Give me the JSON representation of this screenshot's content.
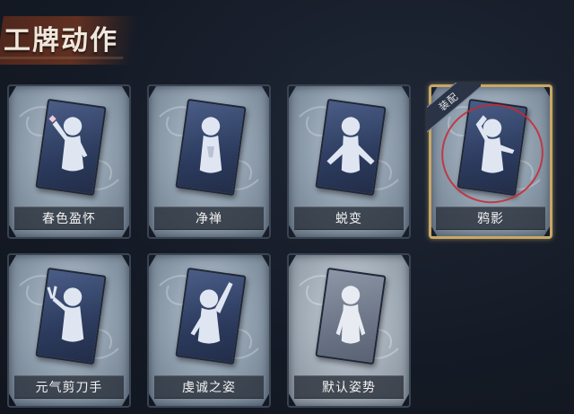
{
  "header": {
    "title": "工牌动作"
  },
  "cards": [
    {
      "label": "春色盈怀",
      "pose": "heart-hands-icon",
      "equipped": false,
      "dim": false
    },
    {
      "label": "净禅",
      "pose": "meditate-icon",
      "equipped": false,
      "dim": false
    },
    {
      "label": "蜕变",
      "pose": "spread-arms-icon",
      "equipped": false,
      "dim": false
    },
    {
      "label": "鸦影",
      "pose": "hand-on-head-icon",
      "equipped": true,
      "dim": false
    },
    {
      "label": "元气剪刀手",
      "pose": "peace-sign-icon",
      "equipped": false,
      "dim": false
    },
    {
      "label": "虔诚之姿",
      "pose": "raised-arm-icon",
      "equipped": false,
      "dim": false
    },
    {
      "label": "默认姿势",
      "pose": "default-pose-icon",
      "equipped": false,
      "dim": true
    }
  ],
  "equip_badge": {
    "label": "装配"
  },
  "colors": {
    "background": "#151b26",
    "title_banner": "#6e3522",
    "equipped_border": "#c8a866",
    "selection_circle": "#c82832"
  }
}
